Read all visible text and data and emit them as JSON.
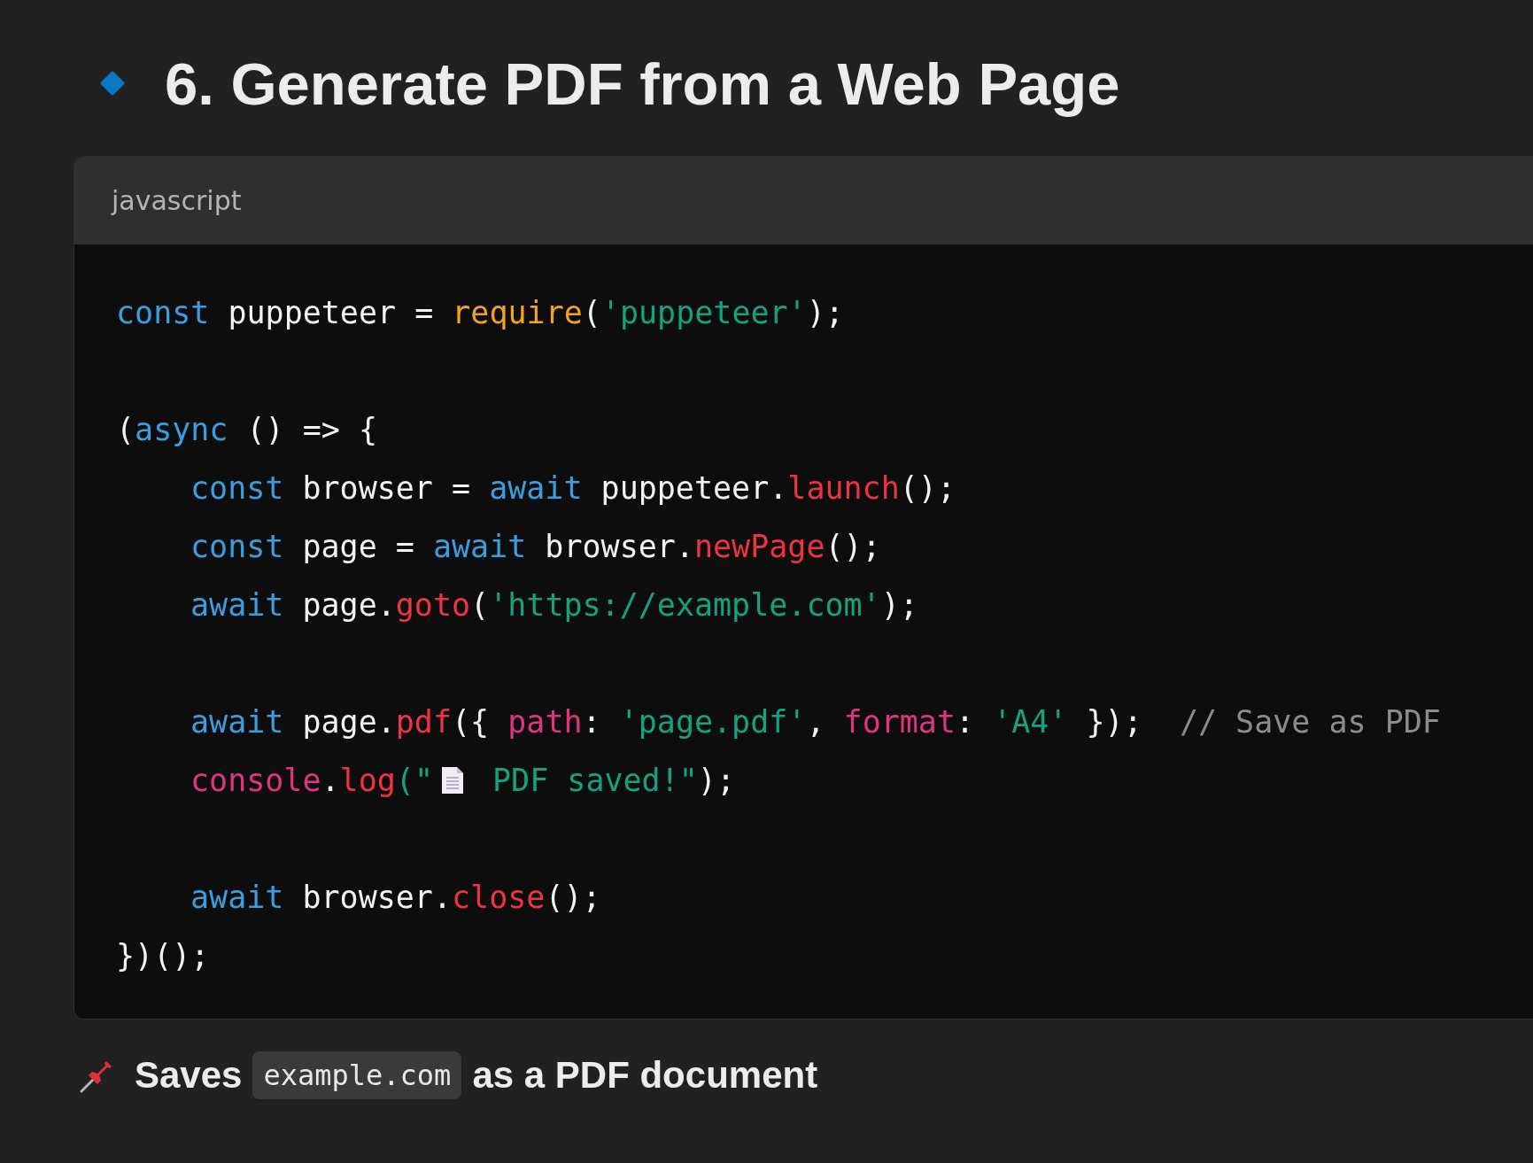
{
  "heading": {
    "text": "6. Generate PDF from a Web Page"
  },
  "code_block": {
    "language": "javascript",
    "lines": [
      {
        "kind": "code",
        "segments": [
          {
            "kind": "text",
            "tokens": [
              {
                "t": "const",
                "kind": "keyword"
              },
              {
                "t": " puppeteer = ",
                "kind": "plain"
              },
              {
                "t": "require",
                "kind": "builtin"
              },
              {
                "t": "(",
                "kind": "plain"
              },
              {
                "t": "'puppeteer'",
                "kind": "string"
              },
              {
                "t": ");",
                "kind": "plain"
              }
            ]
          }
        ]
      },
      {
        "kind": "blank"
      },
      {
        "kind": "code",
        "segments": [
          {
            "kind": "text",
            "tokens": [
              {
                "t": "(",
                "kind": "plain"
              },
              {
                "t": "async",
                "kind": "keyword"
              },
              {
                "t": " () => {",
                "kind": "plain"
              }
            ]
          }
        ]
      },
      {
        "kind": "indented_code",
        "segments": [
          {
            "kind": "text",
            "tokens": [
              {
                "t": "const",
                "kind": "keyword"
              },
              {
                "t": " browser = ",
                "kind": "plain"
              },
              {
                "t": "await",
                "kind": "keyword"
              },
              {
                "t": " puppeteer.",
                "kind": "plain"
              },
              {
                "t": "launch",
                "kind": "method"
              },
              {
                "t": "();",
                "kind": "plain"
              }
            ]
          }
        ]
      },
      {
        "kind": "indented_code",
        "segments": [
          {
            "kind": "text",
            "tokens": [
              {
                "t": "const",
                "kind": "keyword"
              },
              {
                "t": " page = ",
                "kind": "plain"
              },
              {
                "t": "await",
                "kind": "keyword"
              },
              {
                "t": " browser.",
                "kind": "plain"
              },
              {
                "t": "newPage",
                "kind": "method"
              },
              {
                "t": "();",
                "kind": "plain"
              }
            ]
          }
        ]
      },
      {
        "kind": "indented_code",
        "segments": [
          {
            "kind": "text",
            "tokens": [
              {
                "t": "await",
                "kind": "keyword"
              },
              {
                "t": " page.",
                "kind": "plain"
              },
              {
                "t": "goto",
                "kind": "method"
              },
              {
                "t": "(",
                "kind": "plain"
              },
              {
                "t": "'https://example.com'",
                "kind": "string"
              },
              {
                "t": ");",
                "kind": "plain"
              }
            ]
          }
        ]
      },
      {
        "kind": "blank"
      },
      {
        "kind": "indented_code",
        "segments": [
          {
            "kind": "text",
            "tokens": [
              {
                "t": "await",
                "kind": "keyword"
              },
              {
                "t": " page.",
                "kind": "plain"
              },
              {
                "t": "pdf",
                "kind": "method"
              },
              {
                "t": "({ ",
                "kind": "plain"
              },
              {
                "t": "path",
                "kind": "property"
              },
              {
                "t": ": ",
                "kind": "plain"
              },
              {
                "t": "'page.pdf'",
                "kind": "string"
              },
              {
                "t": ", ",
                "kind": "plain"
              },
              {
                "t": "format",
                "kind": "property"
              },
              {
                "t": ": ",
                "kind": "plain"
              },
              {
                "t": "'A4'",
                "kind": "string"
              },
              {
                "t": " });  ",
                "kind": "plain"
              },
              {
                "t": "// Save as PDF",
                "kind": "comment"
              }
            ]
          }
        ]
      },
      {
        "kind": "indented_code",
        "segments": [
          {
            "kind": "text",
            "tokens": [
              {
                "t": "console",
                "kind": "property"
              },
              {
                "t": ".",
                "kind": "plain"
              },
              {
                "t": "log",
                "kind": "method"
              },
              {
                "t": "(\"",
                "kind": "string"
              }
            ]
          },
          {
            "kind": "document_icon"
          },
          {
            "kind": "text",
            "tokens": [
              {
                "t": " PDF saved!\"",
                "kind": "string"
              },
              {
                "t": ");",
                "kind": "plain"
              }
            ]
          }
        ]
      },
      {
        "kind": "blank"
      },
      {
        "kind": "indented_code",
        "segments": [
          {
            "kind": "text",
            "tokens": [
              {
                "t": "await",
                "kind": "keyword"
              },
              {
                "t": " browser.",
                "kind": "plain"
              },
              {
                "t": "close",
                "kind": "method"
              },
              {
                "t": "();",
                "kind": "plain"
              }
            ]
          }
        ]
      },
      {
        "kind": "code",
        "segments": [
          {
            "kind": "text",
            "tokens": [
              {
                "t": "})();",
                "kind": "plain"
              }
            ]
          }
        ]
      }
    ]
  },
  "note": {
    "parts": [
      {
        "kind": "text",
        "text": "Saves"
      },
      {
        "kind": "code",
        "text": "example.com"
      },
      {
        "kind": "text",
        "text": "as a PDF document"
      }
    ]
  }
}
